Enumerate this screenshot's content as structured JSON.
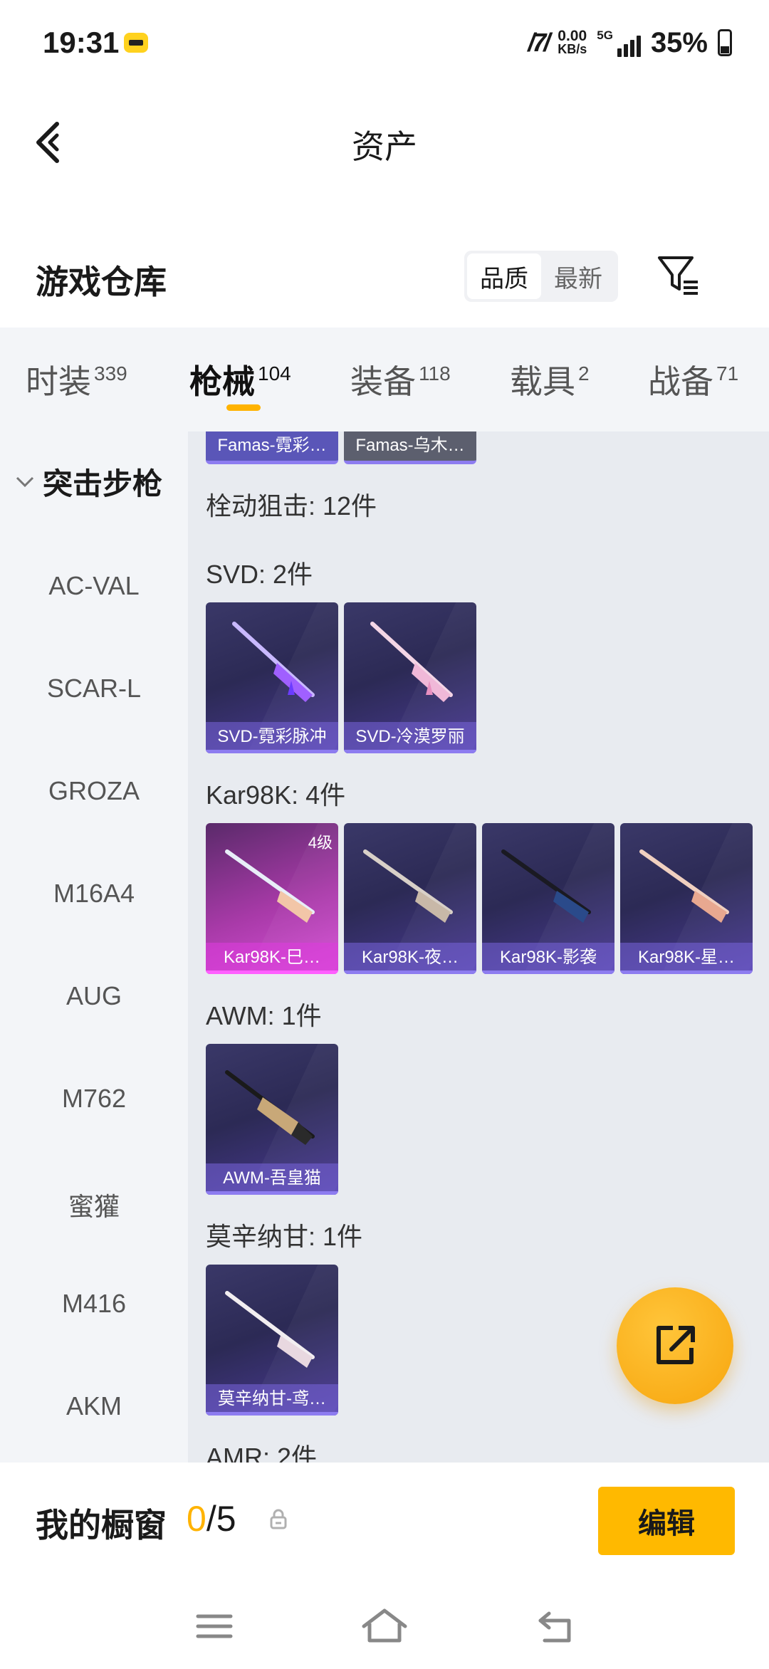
{
  "status_bar": {
    "time": "19:31",
    "speed_value": "0.00",
    "speed_unit": "KB/s",
    "network": "5G",
    "battery": "35%"
  },
  "header": {
    "title": "资产"
  },
  "warehouse": {
    "title": "游戏仓库",
    "sort_options": [
      "品质",
      "最新"
    ],
    "sort_selected": "品质"
  },
  "tabs": [
    {
      "label": "时装",
      "count": "339"
    },
    {
      "label": "枪械",
      "count": "104"
    },
    {
      "label": "装备",
      "count": "118"
    },
    {
      "label": "载具",
      "count": "2"
    },
    {
      "label": "战备",
      "count": "71"
    }
  ],
  "active_tab": "枪械",
  "sidebar": {
    "group": "突击步枪",
    "items": [
      "AC-VAL",
      "SCAR-L",
      "GROZA",
      "M16A4",
      "AUG",
      "M762",
      "蜜獾",
      "M416",
      "AKM"
    ]
  },
  "content": {
    "top_items": [
      "Famas-霓彩…",
      "Famas-乌木…"
    ],
    "category_header": "栓动狙击: 12件",
    "sections": [
      {
        "title": "SVD: 2件",
        "items": [
          "SVD-霓彩脉冲",
          "SVD-冷漠罗丽"
        ]
      },
      {
        "title": "Kar98K: 4件",
        "items": [
          "Kar98K-巳…",
          "Kar98K-夜…",
          "Kar98K-影袭",
          "Kar98K-星…"
        ],
        "level_badge": "4级"
      },
      {
        "title": "AWM: 1件",
        "items": [
          "AWM-吾皇猫"
        ]
      },
      {
        "title": "莫辛纳甘: 1件",
        "items": [
          "莫辛纳甘-鸢…"
        ]
      },
      {
        "title": "AMR: 2件",
        "items": []
      }
    ]
  },
  "showcase": {
    "label": "我的橱窗",
    "current": "0",
    "total": "/5",
    "edit_label": "编辑"
  },
  "colors": {
    "accent": "#ffb900",
    "card_bg": "#2c2a55",
    "card_gold": "#d850d8"
  }
}
